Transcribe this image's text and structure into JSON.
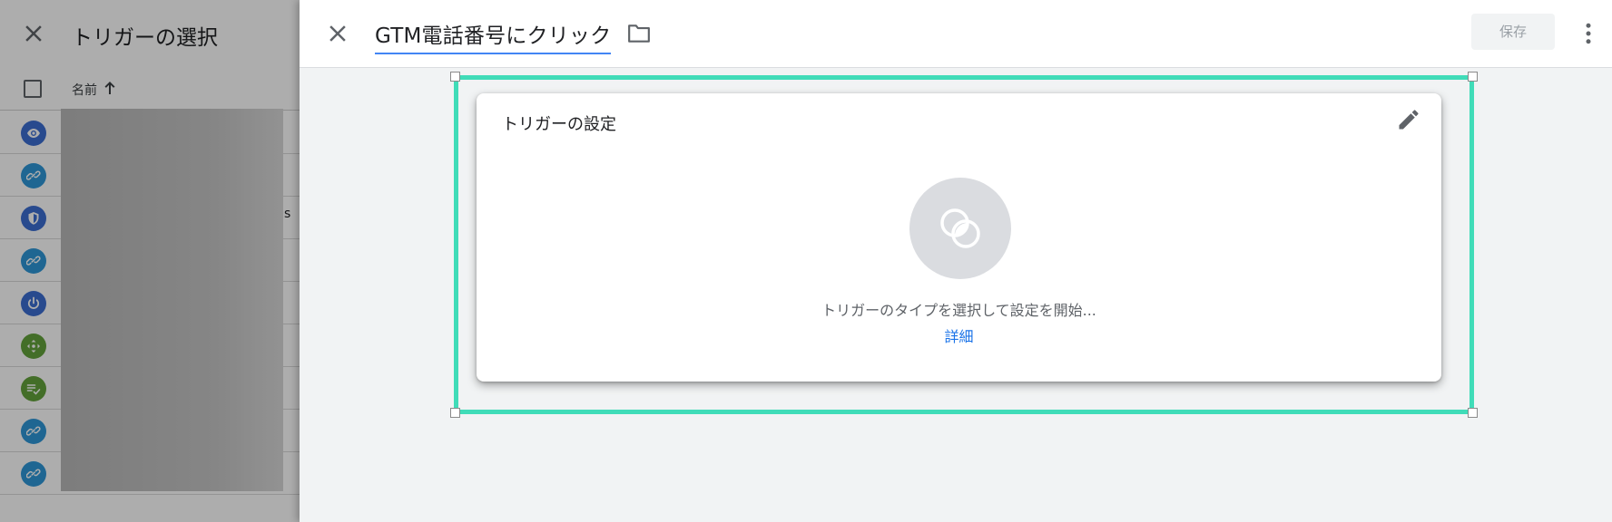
{
  "background_panel": {
    "title": "トリガーの選択",
    "column_name": "名前",
    "row_fragment": "s",
    "rows": [
      {
        "icon": "eye-icon",
        "color": "#3c6ed2"
      },
      {
        "icon": "link-icon",
        "color": "#2f97d8"
      },
      {
        "icon": "shield-icon",
        "color": "#3c6ed2"
      },
      {
        "icon": "link-icon",
        "color": "#2f97d8"
      },
      {
        "icon": "power-icon",
        "color": "#3c6ed2"
      },
      {
        "icon": "move-icon",
        "color": "#64a23c"
      },
      {
        "icon": "form-check-icon",
        "color": "#64a23c"
      },
      {
        "icon": "link-icon",
        "color": "#2f97d8"
      },
      {
        "icon": "link-icon",
        "color": "#2f97d8"
      }
    ]
  },
  "header": {
    "title": "GTM電話番号にクリック",
    "save_label": "保存"
  },
  "card": {
    "title": "トリガーの設定",
    "hint": "トリガーのタイプを選択して設定を開始...",
    "link": "詳細"
  },
  "colors": {
    "selection_frame": "#40dcb8",
    "link": "#1a73e8",
    "title_underline": "#4285f4"
  }
}
